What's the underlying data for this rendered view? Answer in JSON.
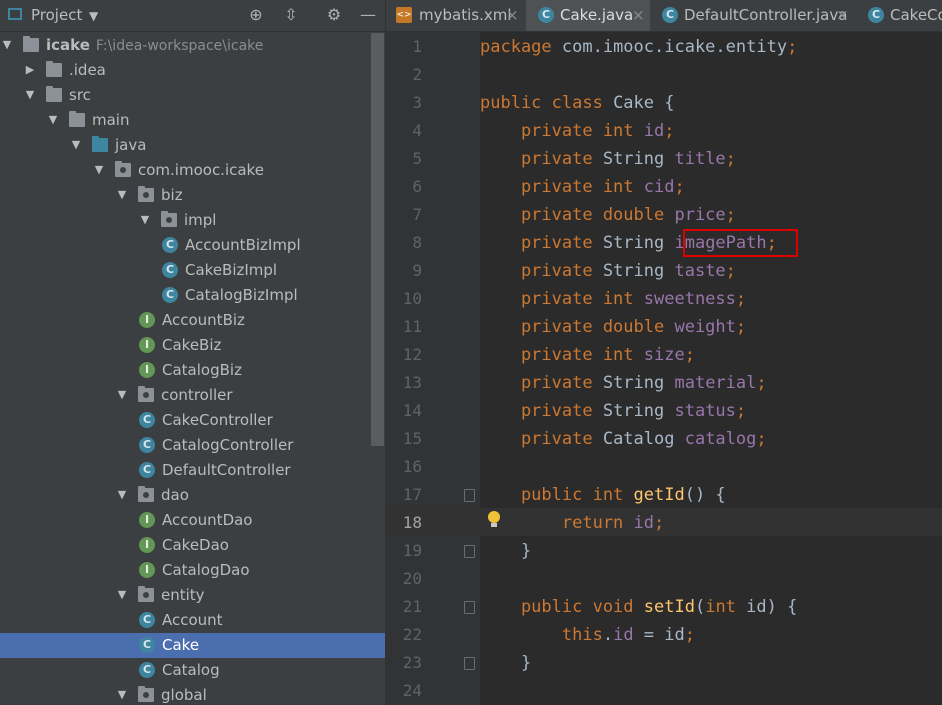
{
  "project_bar": {
    "title": "Project"
  },
  "tree": [
    {
      "label": "icake",
      "path": "F:\\idea-workspace\\icake",
      "toggle": "open"
    },
    {
      "label": ".idea",
      "toggle": "closed"
    },
    {
      "label": "src",
      "toggle": "open"
    },
    {
      "label": "main",
      "toggle": "open"
    },
    {
      "label": "java",
      "toggle": "open"
    },
    {
      "label": "com.imooc.icake",
      "toggle": "open"
    },
    {
      "label": "biz",
      "toggle": "open"
    },
    {
      "label": "impl",
      "toggle": "open"
    },
    {
      "label": "AccountBizImpl",
      "badge": "C"
    },
    {
      "label": "CakeBizImpl",
      "badge": "C"
    },
    {
      "label": "CatalogBizImpl",
      "badge": "C"
    },
    {
      "label": "AccountBiz",
      "badge": "I"
    },
    {
      "label": "CakeBiz",
      "badge": "I"
    },
    {
      "label": "CatalogBiz",
      "badge": "I"
    },
    {
      "label": "controller",
      "toggle": "open"
    },
    {
      "label": "CakeController",
      "badge": "C"
    },
    {
      "label": "CatalogController",
      "badge": "C"
    },
    {
      "label": "DefaultController",
      "badge": "C"
    },
    {
      "label": "dao",
      "toggle": "open"
    },
    {
      "label": "AccountDao",
      "badge": "I"
    },
    {
      "label": "CakeDao",
      "badge": "I"
    },
    {
      "label": "CatalogDao",
      "badge": "I"
    },
    {
      "label": "entity",
      "toggle": "open"
    },
    {
      "label": "Account",
      "badge": "C"
    },
    {
      "label": "Cake",
      "badge": "C",
      "selected": true
    },
    {
      "label": "Catalog",
      "badge": "C"
    },
    {
      "label": "global",
      "toggle": "open"
    }
  ],
  "tabs": [
    {
      "label": "mybatis.xml",
      "close": "×"
    },
    {
      "label": "Cake.java",
      "close": "×"
    },
    {
      "label": "DefaultController.java",
      "close": "×"
    },
    {
      "label": "CakeCo"
    }
  ],
  "editor": {
    "current_line": 18,
    "lines": [
      {
        "n": "1",
        "t": [
          [
            "package ",
            "kw"
          ],
          [
            "com.imooc.icake.entity",
            ""
          ],
          [
            ";",
            "kw"
          ]
        ]
      },
      {
        "n": "2",
        "t": []
      },
      {
        "n": "3",
        "t": [
          [
            "public class ",
            "kw"
          ],
          [
            "Cake {",
            ""
          ]
        ]
      },
      {
        "n": "4",
        "t": [
          [
            "    private int ",
            "kw"
          ],
          [
            "id",
            "fld"
          ],
          [
            ";",
            "kw"
          ]
        ]
      },
      {
        "n": "5",
        "t": [
          [
            "    private ",
            "kw"
          ],
          [
            "String ",
            ""
          ],
          [
            "title",
            "fld"
          ],
          [
            ";",
            "kw"
          ]
        ]
      },
      {
        "n": "6",
        "t": [
          [
            "    private int ",
            "kw"
          ],
          [
            "cid",
            "fld"
          ],
          [
            ";",
            "kw"
          ]
        ]
      },
      {
        "n": "7",
        "t": [
          [
            "    private double ",
            "kw"
          ],
          [
            "price",
            "fld"
          ],
          [
            ";",
            "kw"
          ]
        ]
      },
      {
        "n": "8",
        "t": [
          [
            "    private ",
            "kw"
          ],
          [
            "String ",
            ""
          ],
          [
            "imagePath",
            "fld"
          ],
          [
            ";",
            "kw"
          ]
        ]
      },
      {
        "n": "9",
        "t": [
          [
            "    private ",
            "kw"
          ],
          [
            "String ",
            ""
          ],
          [
            "taste",
            "fld"
          ],
          [
            ";",
            "kw"
          ]
        ]
      },
      {
        "n": "10",
        "t": [
          [
            "    private int ",
            "kw"
          ],
          [
            "sweetness",
            "fld"
          ],
          [
            ";",
            "kw"
          ]
        ]
      },
      {
        "n": "11",
        "t": [
          [
            "    private double ",
            "kw"
          ],
          [
            "weight",
            "fld"
          ],
          [
            ";",
            "kw"
          ]
        ]
      },
      {
        "n": "12",
        "t": [
          [
            "    private int ",
            "kw"
          ],
          [
            "size",
            "fld"
          ],
          [
            ";",
            "kw"
          ]
        ]
      },
      {
        "n": "13",
        "t": [
          [
            "    private ",
            "kw"
          ],
          [
            "String ",
            ""
          ],
          [
            "material",
            "fld"
          ],
          [
            ";",
            "kw"
          ]
        ]
      },
      {
        "n": "14",
        "t": [
          [
            "    private ",
            "kw"
          ],
          [
            "String ",
            ""
          ],
          [
            "status",
            "fld"
          ],
          [
            ";",
            "kw"
          ]
        ]
      },
      {
        "n": "15",
        "t": [
          [
            "    private ",
            "kw"
          ],
          [
            "Catalog ",
            ""
          ],
          [
            "catalog",
            "fld"
          ],
          [
            ";",
            "kw"
          ]
        ]
      },
      {
        "n": "16",
        "t": []
      },
      {
        "n": "17",
        "t": [
          [
            "    public int ",
            "kw"
          ],
          [
            "getId",
            "mth"
          ],
          [
            "() {",
            ""
          ]
        ]
      },
      {
        "n": "18",
        "t": [
          [
            "        return ",
            "kw"
          ],
          [
            "id",
            "fld"
          ],
          [
            ";",
            "kw"
          ]
        ]
      },
      {
        "n": "19",
        "t": [
          [
            "    }",
            ""
          ]
        ]
      },
      {
        "n": "20",
        "t": []
      },
      {
        "n": "21",
        "t": [
          [
            "    public void ",
            "kw"
          ],
          [
            "setId",
            "mth"
          ],
          [
            "(",
            ""
          ],
          [
            "int ",
            "kw"
          ],
          [
            "id) {",
            ""
          ]
        ]
      },
      {
        "n": "22",
        "t": [
          [
            "        this",
            "kw"
          ],
          [
            ".",
            ""
          ],
          [
            "id",
            "fld"
          ],
          [
            " = id",
            ""
          ],
          [
            ";",
            "kw"
          ]
        ]
      },
      {
        "n": "23",
        "t": [
          [
            "    }",
            ""
          ]
        ]
      },
      {
        "n": "24",
        "t": []
      }
    ]
  },
  "colors": {
    "keyword": "#cc7832",
    "field": "#9876aa",
    "method": "#ffc66d",
    "text": "#a9b7c6",
    "highlight_box": "#e00000"
  }
}
